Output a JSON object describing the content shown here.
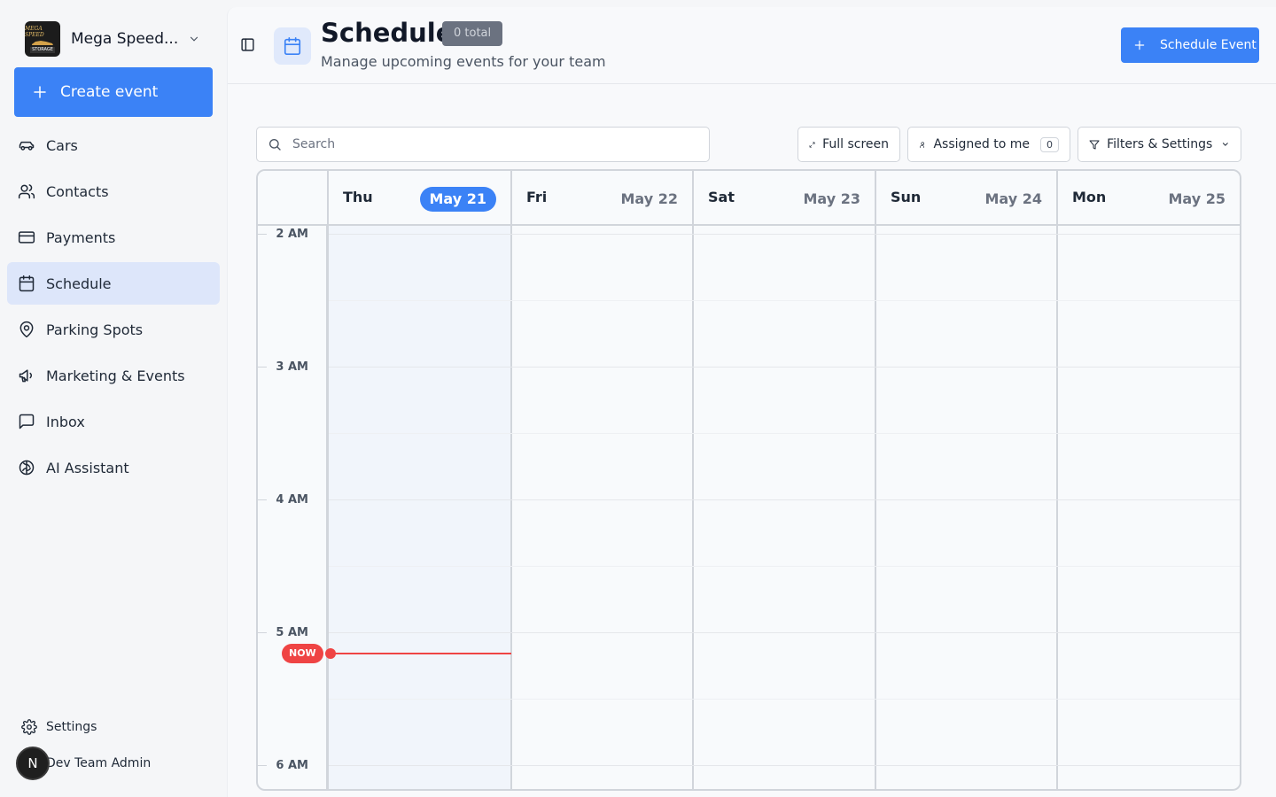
{
  "org": {
    "name": "Mega Speed...",
    "logo_top": "MEGA SPEED",
    "logo_bottom": "STORAGE"
  },
  "sidebar": {
    "create_label": "Create event",
    "items": [
      {
        "label": "Cars",
        "icon": "car-icon"
      },
      {
        "label": "Contacts",
        "icon": "users-icon"
      },
      {
        "label": "Payments",
        "icon": "credit-card-icon"
      },
      {
        "label": "Schedule",
        "icon": "calendar-icon",
        "active": true
      },
      {
        "label": "Parking Spots",
        "icon": "map-pin-icon"
      },
      {
        "label": "Marketing & Events",
        "icon": "megaphone-icon"
      },
      {
        "label": "Inbox",
        "icon": "message-square-icon"
      },
      {
        "label": "AI Assistant",
        "icon": "brain-icon"
      }
    ],
    "settings_label": "Settings",
    "user_initial": "N",
    "user_name": "Dev Team Admin"
  },
  "header": {
    "title": "Schedule",
    "badge": "0 total",
    "subtitle": "Manage upcoming events for your team",
    "schedule_button": "Schedule Event"
  },
  "toolbar": {
    "search_placeholder": "Search",
    "fullscreen_label": "Full screen",
    "assigned_label": "Assigned to me",
    "assigned_count": "0",
    "filters_label": "Filters & Settings"
  },
  "calendar": {
    "days": [
      {
        "name": "Thu",
        "date": "May 21",
        "today": true
      },
      {
        "name": "Fri",
        "date": "May 22"
      },
      {
        "name": "Sat",
        "date": "May 23"
      },
      {
        "name": "Sun",
        "date": "May 24"
      },
      {
        "name": "Mon",
        "date": "May 25"
      }
    ],
    "times": [
      "2 AM",
      "3 AM",
      "4 AM",
      "5 AM",
      "6 AM"
    ],
    "now_label": "NOW"
  },
  "colors": {
    "accent": "#3b82f6",
    "now": "#ef4444",
    "active_nav": "#dde6fa"
  }
}
